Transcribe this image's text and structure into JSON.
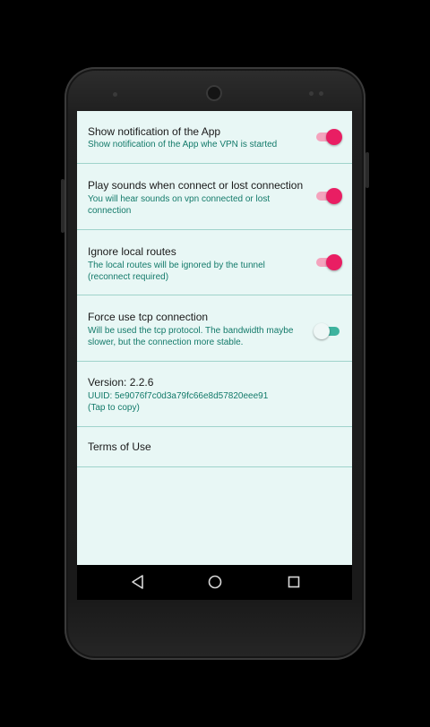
{
  "settings": [
    {
      "title": "Show notification of the App",
      "summary": "Show notification of the App whe VPN is started",
      "switch_state": "on"
    },
    {
      "title": "Play sounds when connect or lost connection",
      "summary": "You will hear sounds on vpn connected or lost connection",
      "switch_state": "on"
    },
    {
      "title": "Ignore local routes",
      "summary": "The local routes will be ignored by the tunnel (reconnect required)",
      "switch_state": "on"
    },
    {
      "title": "Force use tcp connection",
      "summary": "Will be used the tcp protocol. The bandwidth maybe slower, but the connection more stable.",
      "switch_state": "off"
    }
  ],
  "version": {
    "title": "Version: 2.2.6",
    "uuid_line": "UUID: 5e9076f7c0d3a79fc66e8d57820eee91",
    "copy_hint": "(Tap to copy)"
  },
  "terms": {
    "title": "Terms of Use"
  },
  "navbar": {
    "back_icon": "triangle-back-icon",
    "home_icon": "circle-home-icon",
    "recents_icon": "square-recents-icon"
  },
  "colors": {
    "screen_background": "#e8f7f5",
    "summary_text": "#137a6a",
    "divider": "#9fd3cb",
    "switch_on_thumb": "#e91e63",
    "switch_on_track": "#f4a3bd",
    "switch_off_track": "#3db39e"
  }
}
